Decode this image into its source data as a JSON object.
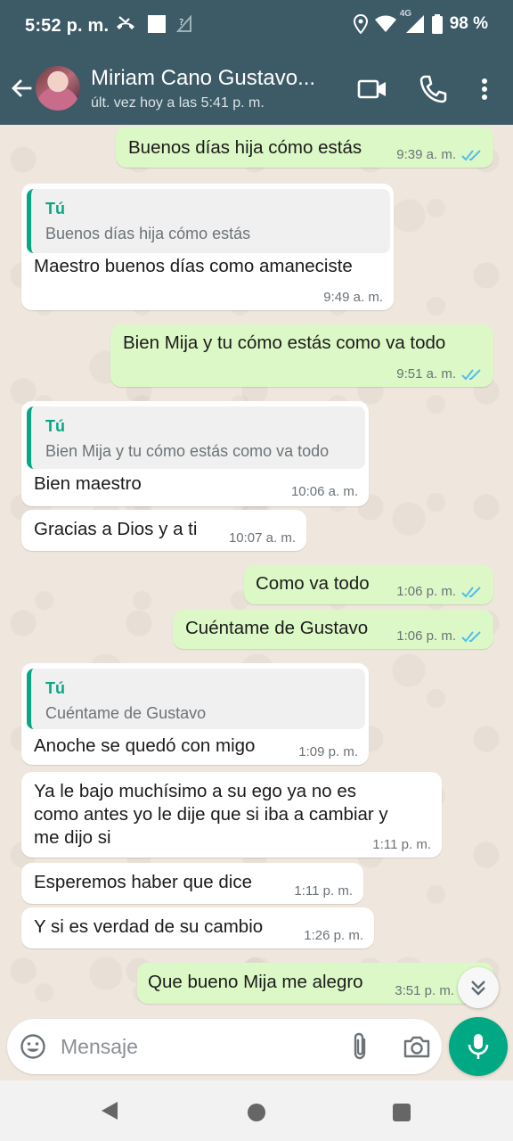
{
  "status_bar": {
    "time": "5:52 p. m.",
    "battery": "98 %",
    "network_label": "4G"
  },
  "header": {
    "contact_name": "Miriam Cano Gustavo...",
    "last_seen": "últ. vez hoy a las 5:41 p. m."
  },
  "messages": [
    {
      "dir": "out",
      "text": "Buenos días hija cómo estás",
      "time": "9:39 a. m.",
      "read": true
    },
    {
      "dir": "in",
      "quote_author": "Tú",
      "quote_text": "Buenos días hija cómo estás",
      "text": "Maestro buenos días como amaneciste",
      "time": "9:49 a. m."
    },
    {
      "dir": "out",
      "text": "Bien Mija y tu cómo estás como va todo",
      "time": "9:51 a. m.",
      "read": true
    },
    {
      "dir": "in",
      "quote_author": "Tú",
      "quote_text": "Bien Mija y tu cómo estás como va todo",
      "text": "Bien maestro",
      "time": "10:06 a. m."
    },
    {
      "dir": "in",
      "text": "Gracias a Dios y a ti",
      "time": "10:07 a. m."
    },
    {
      "dir": "out",
      "text": "Como va todo",
      "time": "1:06 p. m.",
      "read": true
    },
    {
      "dir": "out",
      "text": "Cuéntame de Gustavo",
      "time": "1:06 p. m.",
      "read": true
    },
    {
      "dir": "in",
      "quote_author": "Tú",
      "quote_text": "Cuéntame de Gustavo",
      "text": "Anoche se quedó con migo",
      "time": "1:09 p. m."
    },
    {
      "dir": "in",
      "text_lines": [
        "Ya le bajo muchísimo a su ego ya no es",
        "como antes yo le dije que si iba a cambiar y",
        "me dijo si"
      ],
      "time": "1:11 p. m."
    },
    {
      "dir": "in",
      "text": "Esperemos haber que dice",
      "time": "1:11 p. m."
    },
    {
      "dir": "in",
      "text": "Y si es verdad de su cambio",
      "time": "1:26 p. m."
    },
    {
      "dir": "out",
      "text": "Que bueno Mija me alegro",
      "time": "3:51 p. m.",
      "read": true
    }
  ],
  "composer": {
    "placeholder": "Mensaje"
  },
  "icons": {
    "back": "arrow-left-icon",
    "video": "video-call-icon",
    "call": "phone-icon",
    "menu": "more-vert-icon",
    "emoji": "emoji-icon",
    "attach": "paperclip-icon",
    "camera": "camera-icon",
    "mic": "mic-icon",
    "scroll": "double-chevron-down-icon"
  },
  "colors": {
    "header": "#3d5a67",
    "outgoing_bubble": "#dcf8c6",
    "incoming_bubble": "#ffffff",
    "accent": "#00a884",
    "read_ticks": "#53bdeb"
  }
}
